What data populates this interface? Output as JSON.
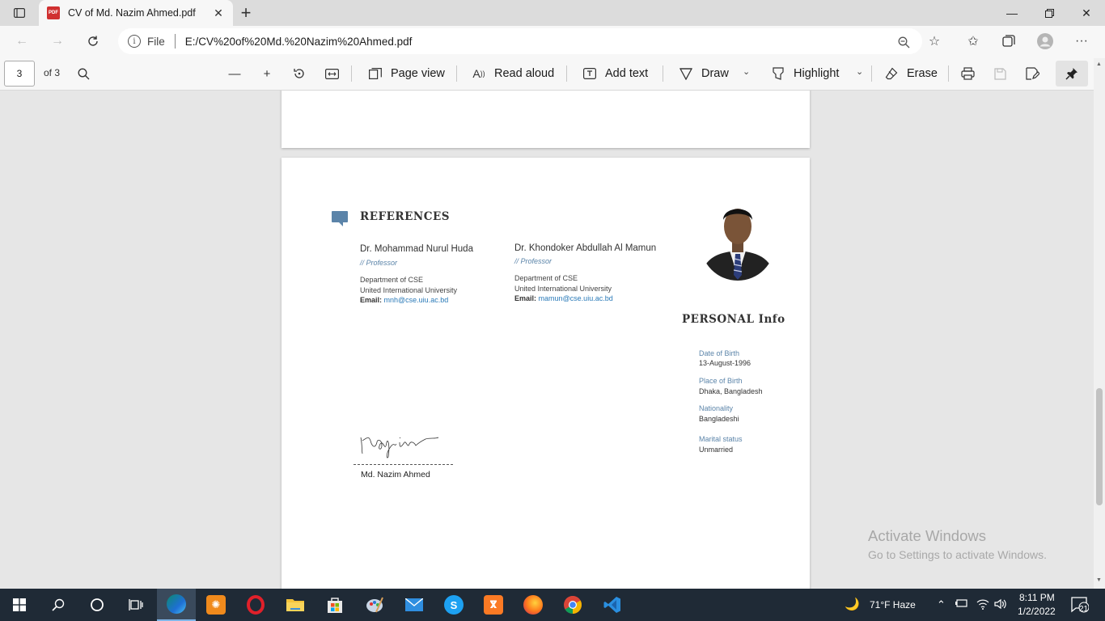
{
  "browser": {
    "tab_title": "CV of Md. Nazim Ahmed.pdf",
    "file_label": "File",
    "url": "E:/CV%20of%20Md.%20Nazim%20Ahmed.pdf"
  },
  "pdf_toolbar": {
    "page_number": "3",
    "page_of": "of 3",
    "page_view": "Page view",
    "read_aloud": "Read aloud",
    "add_text": "Add text",
    "draw": "Draw",
    "highlight": "Highlight",
    "erase": "Erase"
  },
  "document": {
    "references_title": "REFERENCES",
    "references": [
      {
        "name": "Dr. Mohammad Nurul Huda",
        "role": "// Professor",
        "department": "Department of CSE",
        "university": "United International University",
        "email_label": "Email:",
        "email": "mnh@cse.uiu.ac.bd"
      },
      {
        "name": "Dr. Khondoker Abdullah Al Mamun",
        "role": "// Professor",
        "department": "Department of CSE",
        "university": "United International University",
        "email_label": "Email:",
        "email": "mamun@cse.uiu.ac.bd"
      }
    ],
    "personal_title": "PERSONAL Info",
    "personal": [
      {
        "label": "Date of Birth",
        "value": "13-August-1996"
      },
      {
        "label": "Place of Birth",
        "value": "Dhaka, Bangladesh"
      },
      {
        "label": "Nationality",
        "value": "Bangladeshi"
      },
      {
        "label": "Marital status",
        "value": "Unmarried"
      }
    ],
    "signature_name": "Md. Nazim Ahmed",
    "signature_script": "Nazim"
  },
  "watermark": {
    "line1": "Activate Windows",
    "line2": "Go to Settings to activate Windows."
  },
  "taskbar": {
    "weather": "71°F  Haze",
    "time": "8:11 PM",
    "date": "1/2/2022",
    "notifications": "21"
  }
}
